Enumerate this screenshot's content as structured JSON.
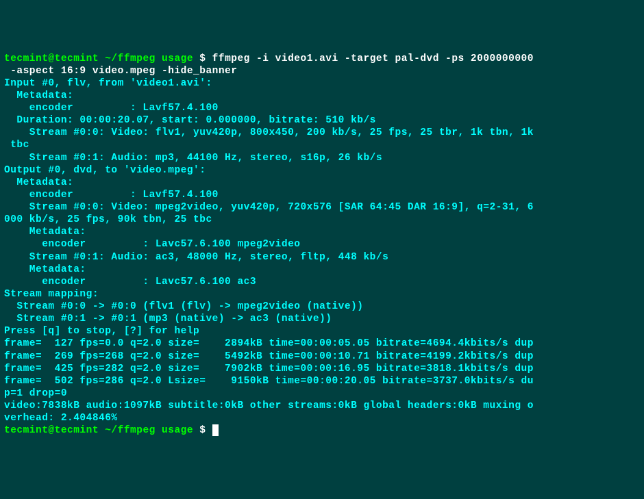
{
  "prompt": {
    "user_host": "tecmint@tecmint",
    "path": "~/ffmpeg usage",
    "dollar": "$"
  },
  "command_line1": "ffmpeg -i video1.avi -target pal-dvd -ps 2000000000",
  "command_line2": " -aspect 16:9 video.mpeg -hide_banner",
  "output": {
    "l1": "Input #0, flv, from 'video1.avi':",
    "l2": "  Metadata:",
    "l3": "    encoder         : Lavf57.4.100",
    "l4": "  Duration: 00:00:20.07, start: 0.000000, bitrate: 510 kb/s",
    "l5": "    Stream #0:0: Video: flv1, yuv420p, 800x450, 200 kb/s, 25 fps, 25 tbr, 1k tbn, 1k",
    "l6": " tbc",
    "l7": "    Stream #0:1: Audio: mp3, 44100 Hz, stereo, s16p, 26 kb/s",
    "l8": "Output #0, dvd, to 'video.mpeg':",
    "l9": "  Metadata:",
    "l10": "    encoder         : Lavf57.4.100",
    "l11": "    Stream #0:0: Video: mpeg2video, yuv420p, 720x576 [SAR 64:45 DAR 16:9], q=2-31, 6",
    "l12": "000 kb/s, 25 fps, 90k tbn, 25 tbc",
    "l13": "    Metadata:",
    "l14": "      encoder         : Lavc57.6.100 mpeg2video",
    "l15": "    Stream #0:1: Audio: ac3, 48000 Hz, stereo, fltp, 448 kb/s",
    "l16": "    Metadata:",
    "l17": "      encoder         : Lavc57.6.100 ac3",
    "l18": "Stream mapping:",
    "l19": "  Stream #0:0 -> #0:0 (flv1 (flv) -> mpeg2video (native))",
    "l20": "  Stream #0:1 -> #0:1 (mp3 (native) -> ac3 (native))",
    "l21": "Press [q] to stop, [?] for help",
    "l22": "frame=  127 fps=0.0 q=2.0 size=    2894kB time=00:00:05.05 bitrate=4694.4kbits/s dup",
    "l23": "frame=  269 fps=268 q=2.0 size=    5492kB time=00:00:10.71 bitrate=4199.2kbits/s dup",
    "l24": "frame=  425 fps=282 q=2.0 size=    7902kB time=00:00:16.95 bitrate=3818.1kbits/s dup",
    "l25": "frame=  502 fps=286 q=2.0 Lsize=    9150kB time=00:00:20.05 bitrate=3737.0kbits/s du",
    "l26": "p=1 drop=0",
    "l27": "video:7838kB audio:1097kB subtitle:0kB other streams:0kB global headers:0kB muxing o",
    "l28": "verhead: 2.404846%"
  }
}
